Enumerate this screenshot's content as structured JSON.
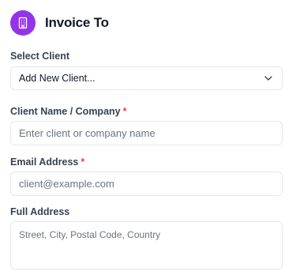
{
  "section": {
    "title": "Invoice To",
    "icon": "building-icon",
    "accent": "#9333ea"
  },
  "select_client": {
    "label": "Select Client",
    "value": "Add New Client..."
  },
  "client_name": {
    "label": "Client Name / Company",
    "required_mark": "*",
    "placeholder": "Enter client or company name",
    "value": ""
  },
  "email": {
    "label": "Email Address",
    "required_mark": "*",
    "placeholder": "client@example.com",
    "value": ""
  },
  "address": {
    "label": "Full Address",
    "placeholder": "Street, City, Postal Code, Country",
    "value": ""
  }
}
